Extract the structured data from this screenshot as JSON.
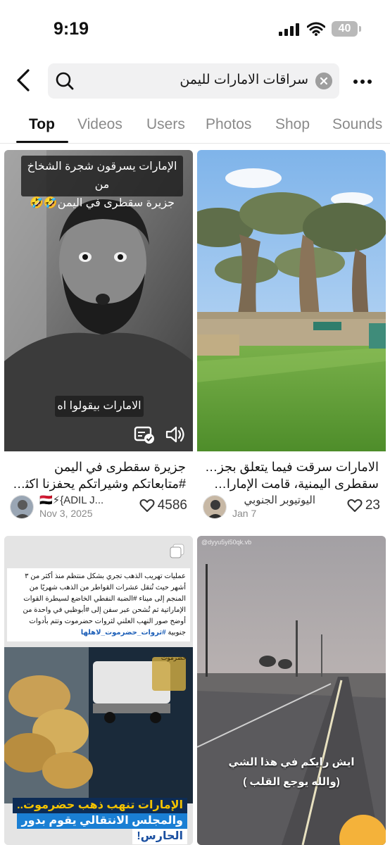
{
  "status_bar": {
    "time": "9:19",
    "battery": "40"
  },
  "search": {
    "query": "سراقات الامارات لليمن"
  },
  "tabs": [
    "Top",
    "Videos",
    "Users",
    "Photos",
    "Shop",
    "Sounds"
  ],
  "results": [
    {
      "overlay_title_line1": "الإمارات يسرقون شجرة الشخاخ من",
      "overlay_title_line2": "جزيرة سقطرى في اليمن🤣🤣",
      "overlay_subtitle": "الامارات بيقولوا اه",
      "caption_line1": "جزيرة سقطرى في اليمن",
      "caption_line2": "#متابعاتكم وشيراتكم يحفزنا اكثر...",
      "author": "🇾🇪⚡{ADIL J...",
      "date": "Nov 3, 2025",
      "likes": "4586"
    },
    {
      "caption_line1": "الامارات سرقت فيما يتعلق بجزيرة",
      "caption_line2": "سقطرى اليمنية، قامت الإمارات ال...",
      "author": "اليوتيوبر الجنوبي",
      "date": "Jan 7",
      "likes": "23"
    },
    {
      "article_text": "عمليات تهريب الذهب تجري بشكل منتظم منذ أكثر من ٣ أشهر حيث تُنقل عشرات القواطر من الذهب شهريًا من المنجم إلى ميناء #الضبة النفطي الخاضع لسيطرة القوات الإماراتية ثم تُشحن عبر سفن إلى #أبوظبي في واحدة من أوضح صور النهب العلني لثروات حضرموت وتتم بأدوات جنوبية",
      "hashtag": "#ثروات_حضرموت_لاهلها",
      "banner_line1": "الإمارات تنهب ذهب حضرموت..",
      "banner_line2": "والمجلس الانتقالي يقوم بدور",
      "banner_line3": "الحارس!",
      "logo_text": "حضرموت"
    },
    {
      "watermark": "@dyyu5yi50qk.vb",
      "overlay_line1": "ايش رايكم في هذا الشي",
      "overlay_line2": "(والله يوجع القلب )"
    }
  ]
}
